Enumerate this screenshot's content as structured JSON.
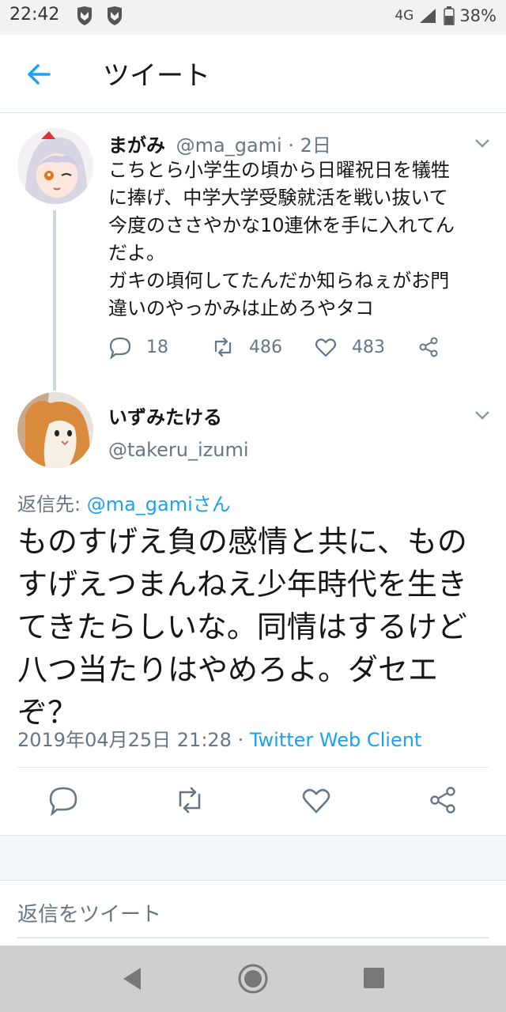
{
  "status_bar": {
    "time": "22:42",
    "network": "4G",
    "battery": "38%"
  },
  "header": {
    "title": "ツイート"
  },
  "parent_tweet": {
    "name": "まがみ",
    "handle": "@ma_gami",
    "time": "· 2日",
    "text": "こちとら小学生の頃から日曜祝日を犠牲\nに捧げ、中学大学受験就活を戦い抜いて\n今度のささやかな10連休を手に入れてん\nだよ。\nガキの頃何してたんだか知らねぇがお門\n違いのやっかみは止めろやタコ",
    "replies": "18",
    "retweets": "486",
    "likes": "483"
  },
  "main_tweet": {
    "name": "いずみたける",
    "handle": "@takeru_izumi",
    "reply_prefix": "返信先: ",
    "reply_target": "@ma_gamiさん",
    "text": "ものすげえ負の感情と共に、ものすげえつまんねえ少年時代を生きてきたらしいな。同情はするけど八つ当たりはやめろよ。ダセエぞ？",
    "timestamp": "2019年04月25日 21:28 · ",
    "client": "Twitter Web Client"
  },
  "reply_box": {
    "placeholder": "返信をツイート"
  },
  "colors": {
    "accent": "#1da1f2",
    "muted": "#657786",
    "border": "#e1e8ed"
  }
}
